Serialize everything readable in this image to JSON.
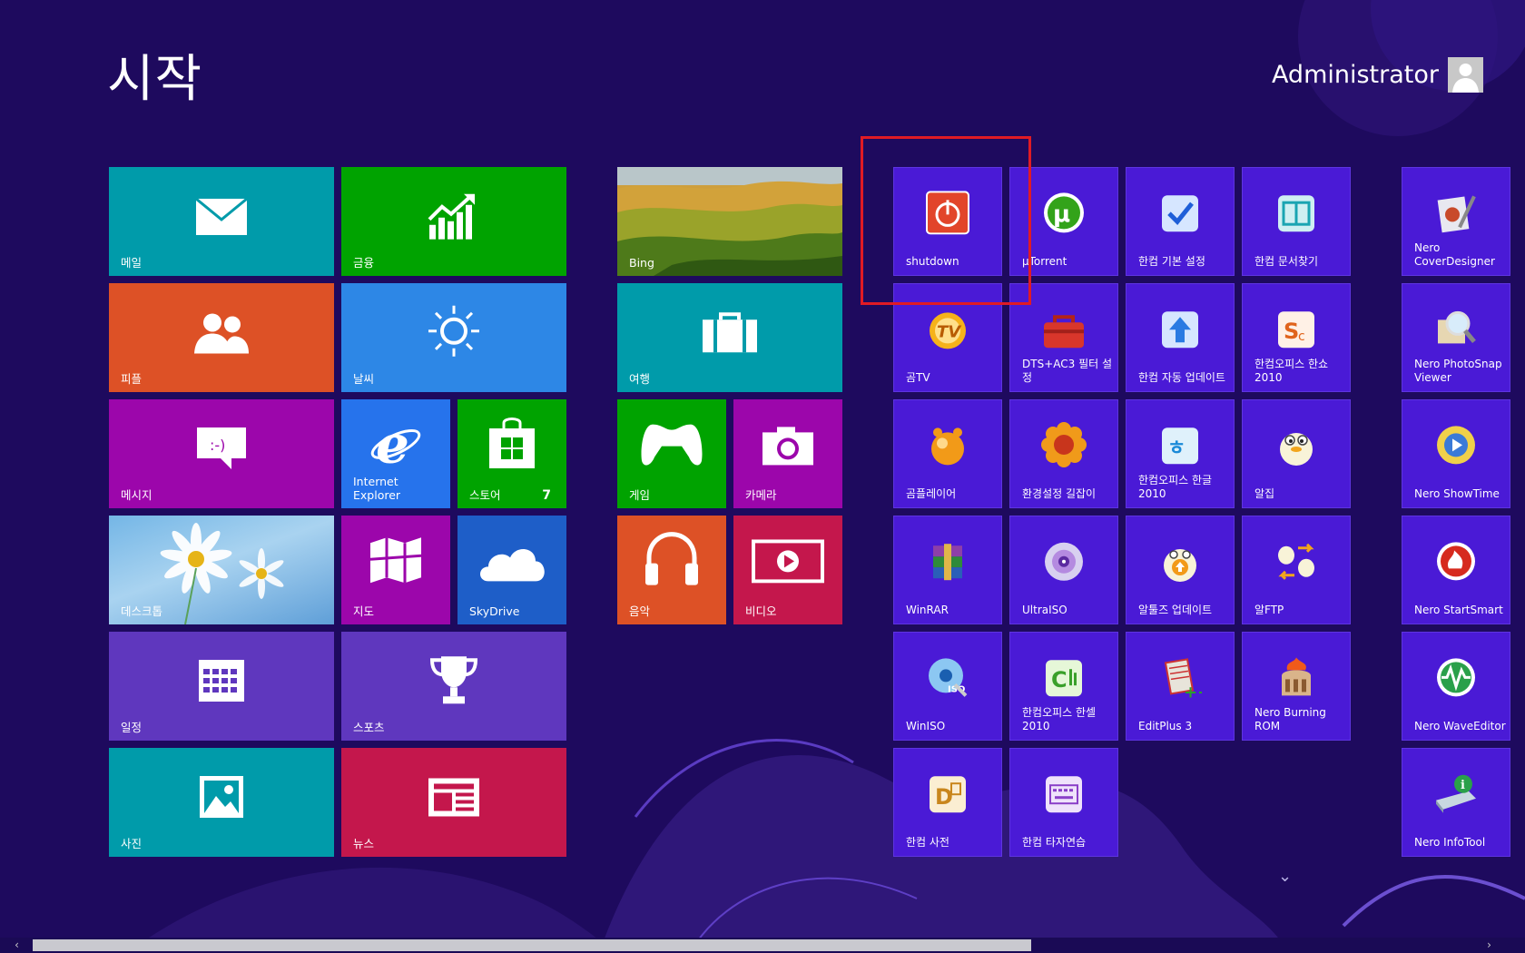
{
  "screen": {
    "title": "시작"
  },
  "user": {
    "name": "Administrator"
  },
  "colors": {
    "background": "#1e0a5e",
    "app_tile": "#4a1ad6",
    "highlight": "#e01b24"
  },
  "groups": {
    "g1": [
      {
        "id": "mail",
        "label": "메일",
        "color": "#009baa",
        "icon": "mail-icon"
      },
      {
        "id": "finance",
        "label": "금융",
        "color": "#00a300",
        "icon": "chart-icon"
      },
      {
        "id": "people",
        "label": "피플",
        "color": "#dd5126",
        "icon": "people-icon"
      },
      {
        "id": "weather",
        "label": "날씨",
        "color": "#2d87e6",
        "icon": "sun-icon"
      },
      {
        "id": "messaging",
        "label": "메시지",
        "color": "#9c06ab",
        "icon": "message-icon"
      },
      {
        "id": "ie",
        "label": "Internet Explorer",
        "color": "#2673ec",
        "icon": "ie-icon"
      },
      {
        "id": "store",
        "label": "스토어",
        "color": "#00a300",
        "icon": "store-icon",
        "badge": "7"
      },
      {
        "id": "desktop",
        "label": "데스크톱",
        "color": "#6fb0e3",
        "icon": "daisy-image"
      },
      {
        "id": "maps",
        "label": "지도",
        "color": "#9c06ab",
        "icon": "map-icon"
      },
      {
        "id": "skydrive",
        "label": "SkyDrive",
        "color": "#1e5ec8",
        "icon": "cloud-icon"
      },
      {
        "id": "calendar",
        "label": "일정",
        "color": "#5f37be",
        "icon": "calendar-icon"
      },
      {
        "id": "sports",
        "label": "스포츠",
        "color": "#5f37be",
        "icon": "trophy-icon"
      },
      {
        "id": "photos",
        "label": "사진",
        "color": "#009baa",
        "icon": "photo-icon"
      },
      {
        "id": "news",
        "label": "뉴스",
        "color": "#c4174c",
        "icon": "news-icon"
      }
    ],
    "g2": [
      {
        "id": "bing",
        "label": "Bing",
        "color": "#8a7a2a",
        "icon": "landscape-image"
      },
      {
        "id": "travel",
        "label": "여행",
        "color": "#009baa",
        "icon": "suitcase-icon"
      },
      {
        "id": "games",
        "label": "게임",
        "color": "#00a300",
        "icon": "xbox-controller-icon"
      },
      {
        "id": "camera",
        "label": "카메라",
        "color": "#9c06ab",
        "icon": "camera-icon"
      },
      {
        "id": "music",
        "label": "음악",
        "color": "#dd5126",
        "icon": "headphones-icon"
      },
      {
        "id": "video",
        "label": "비디오",
        "color": "#c4174c",
        "icon": "play-icon"
      }
    ],
    "g3": [
      {
        "id": "shutdown",
        "label": "shutdown",
        "icon": "power-icon"
      },
      {
        "id": "utorrent",
        "label": "µTorrent",
        "icon": "utorrent-icon"
      },
      {
        "id": "hc-basic",
        "label": "한컴 기본 설정",
        "icon": "checkmark-icon"
      },
      {
        "id": "hc-docfind",
        "label": "한컴 문서찾기",
        "icon": "doc-search-icon"
      },
      {
        "id": "gomtv",
        "label": "곰TV",
        "icon": "gomtv-icon"
      },
      {
        "id": "dts",
        "label": "DTS+AC3 필터 설정",
        "icon": "toolbox-icon"
      },
      {
        "id": "hc-update",
        "label": "한컴 자동 업데이트",
        "icon": "upload-icon"
      },
      {
        "id": "hc-show",
        "label": "한컴오피스 한쇼 2010",
        "icon": "hanshow-icon"
      },
      {
        "id": "gomplayer",
        "label": "곰플레이어",
        "icon": "gomplayer-icon"
      },
      {
        "id": "envset",
        "label": "환경설정 길잡이",
        "icon": "flower-gear-icon"
      },
      {
        "id": "hc-hangul",
        "label": "한컴오피스 한글 2010",
        "icon": "hangul-icon"
      },
      {
        "id": "alzip",
        "label": "알집",
        "icon": "alzip-icon"
      },
      {
        "id": "winrar",
        "label": "WinRAR",
        "icon": "winrar-icon"
      },
      {
        "id": "ultraiso",
        "label": "UltraISO",
        "icon": "disc-icon"
      },
      {
        "id": "altools",
        "label": "알툴즈 업데이트",
        "icon": "altools-update-icon"
      },
      {
        "id": "alftp",
        "label": "알FTP",
        "icon": "alftp-icon"
      },
      {
        "id": "winiso",
        "label": "WinISO",
        "icon": "winiso-icon"
      },
      {
        "id": "hc-cell",
        "label": "한컴오피스 한셀 2010",
        "icon": "hancell-icon"
      },
      {
        "id": "editplus",
        "label": "EditPlus 3",
        "icon": "editplus-icon"
      },
      {
        "id": "nero-burn",
        "label": "Nero Burning ROM",
        "icon": "nero-burn-icon"
      },
      {
        "id": "hc-dict",
        "label": "한컴 사전",
        "icon": "dictionary-icon"
      },
      {
        "id": "hc-typing",
        "label": "한컴 타자연습",
        "icon": "keyboard-icon"
      }
    ],
    "g4": [
      {
        "id": "nero-cover",
        "label": "Nero CoverDesigner",
        "icon": "nero-cover-icon"
      },
      {
        "id": "nero-photosnap",
        "label": "Nero PhotoSnap Viewer",
        "icon": "magnifier-icon"
      },
      {
        "id": "nero-showtime",
        "label": "Nero ShowTime",
        "icon": "showtime-icon"
      },
      {
        "id": "nero-startsmart",
        "label": "Nero StartSmart",
        "icon": "nero-flame-icon"
      },
      {
        "id": "nero-wave",
        "label": "Nero WaveEditor",
        "icon": "wave-icon"
      },
      {
        "id": "nero-info",
        "label": "Nero InfoTool",
        "icon": "drive-info-icon"
      }
    ]
  }
}
